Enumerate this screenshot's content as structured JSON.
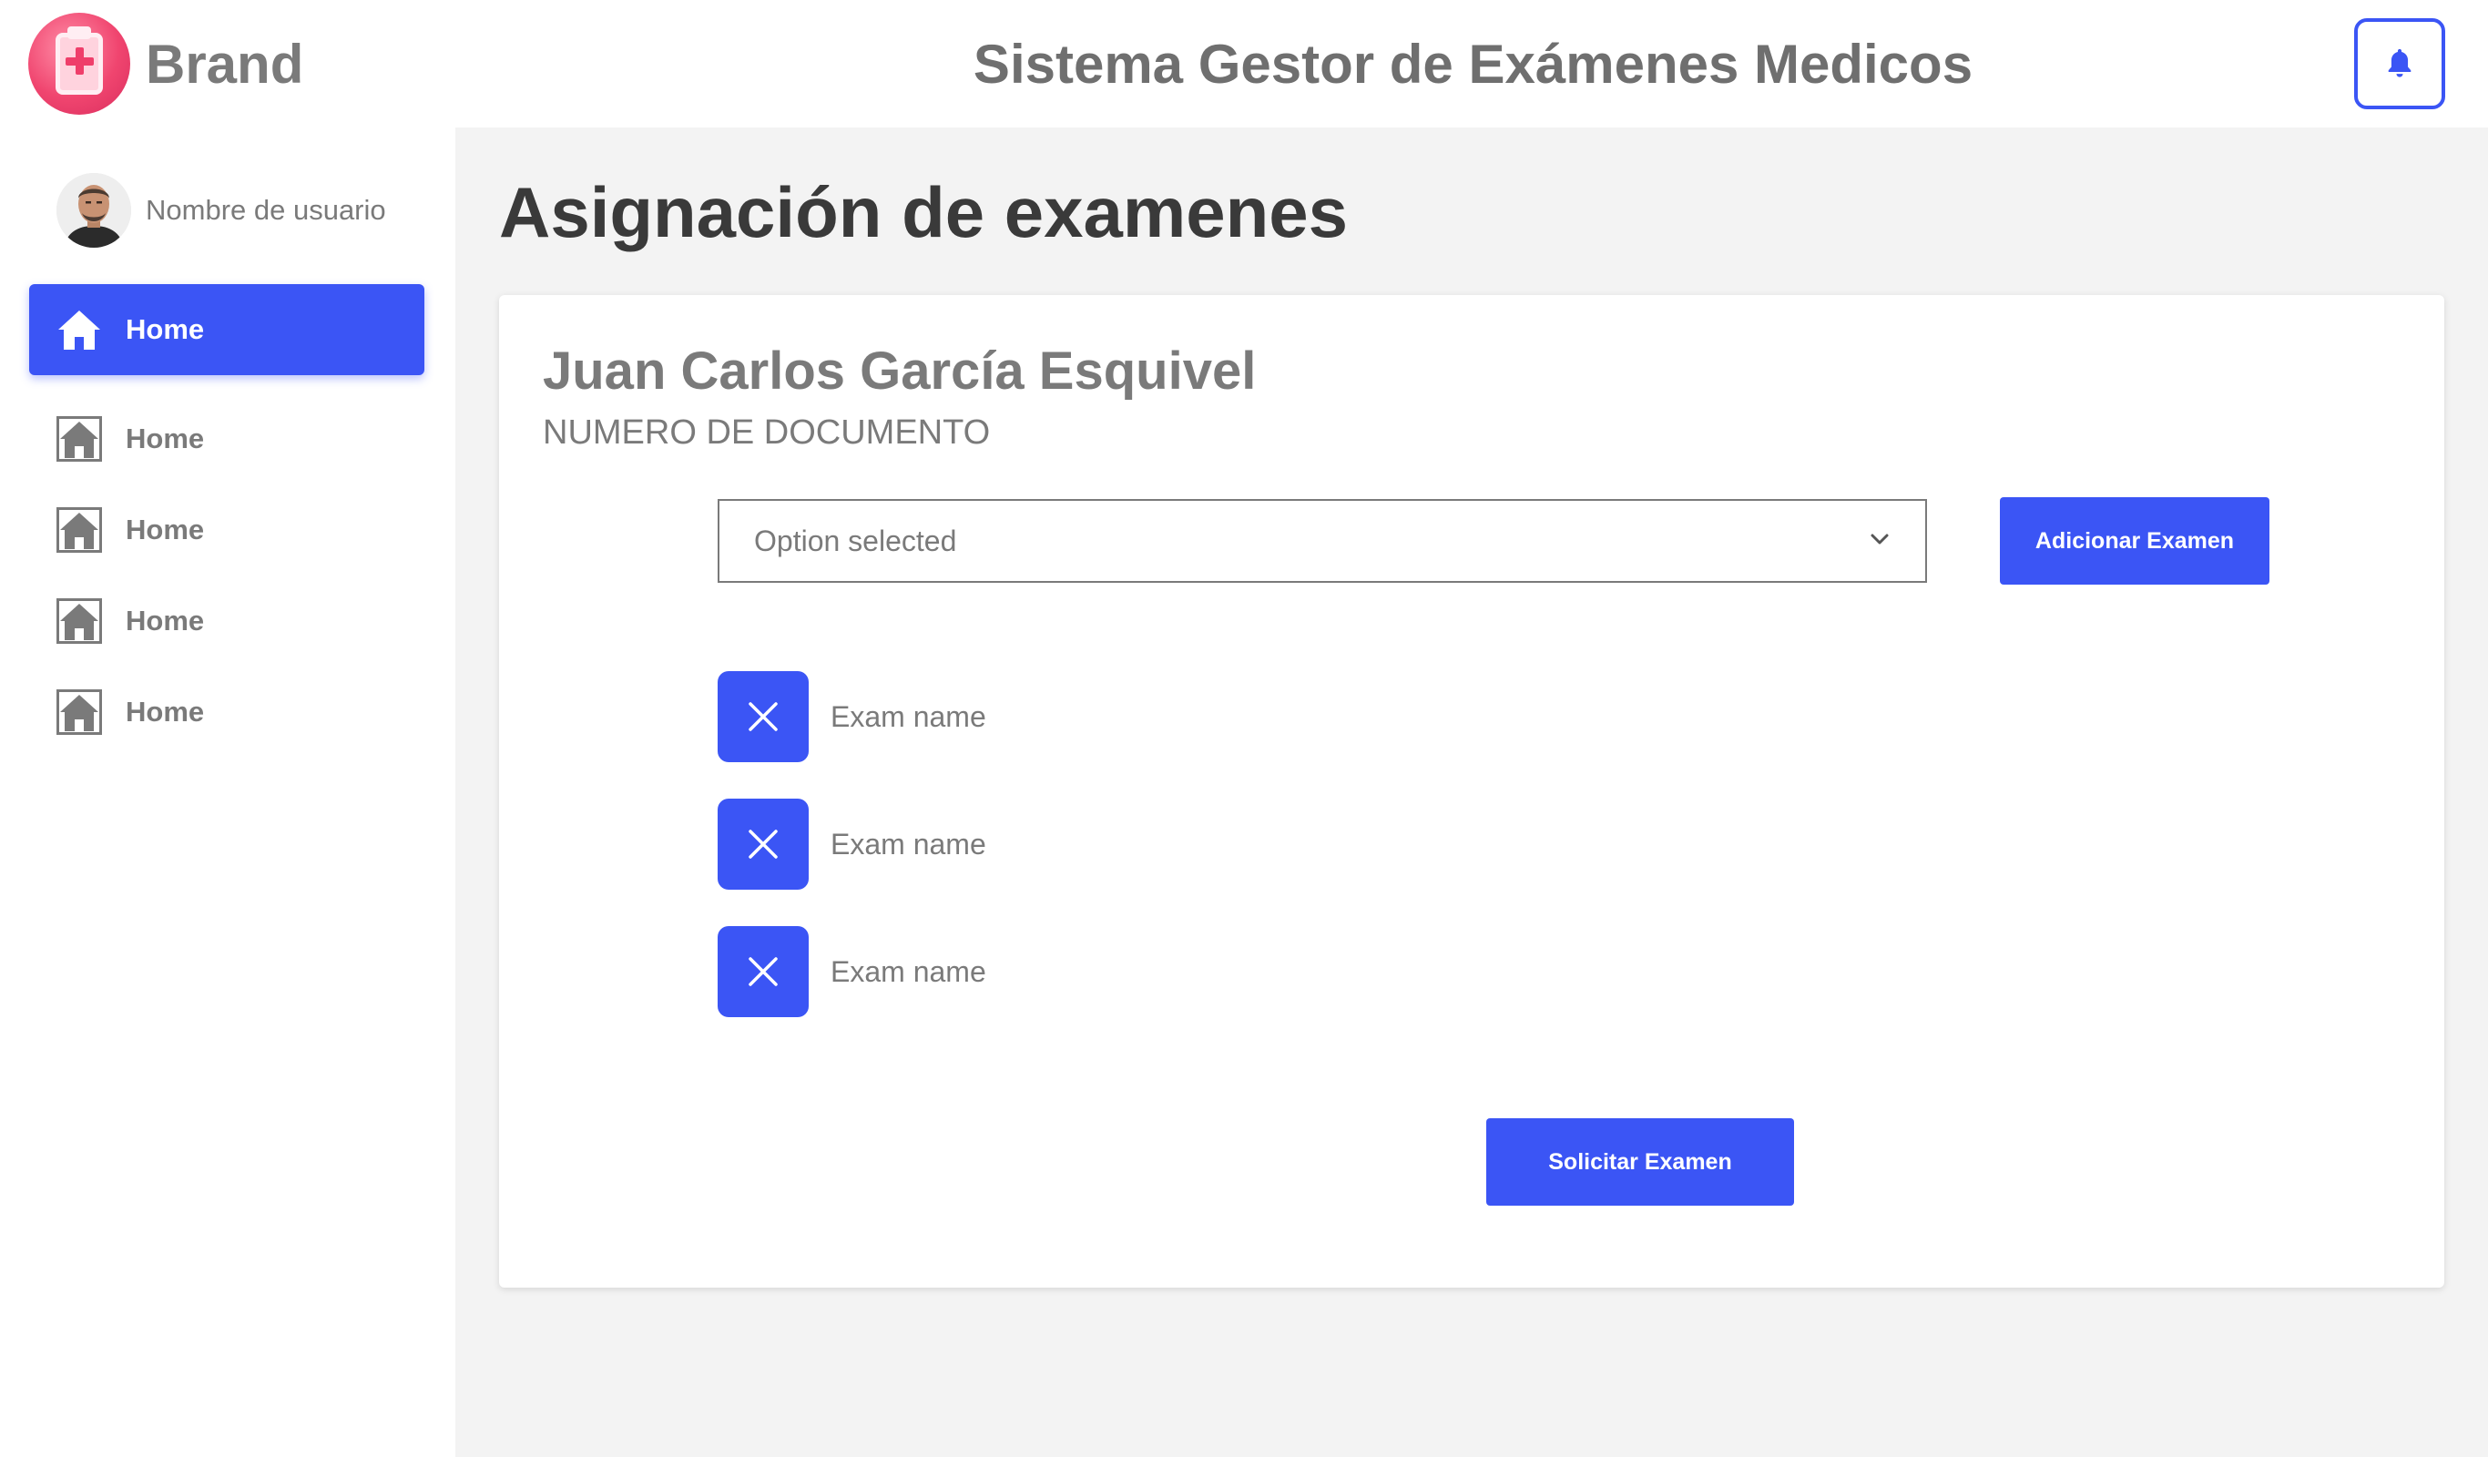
{
  "header": {
    "brand": "Brand",
    "title": "Sistema Gestor de Exámenes Medicos",
    "brand_color": "#f0456f",
    "accent_color": "#3b55f5",
    "icons": {
      "logo": "clipboard-medical-icon",
      "notifications": "bell-icon"
    }
  },
  "sidebar": {
    "user_name": "Nombre de usuario",
    "items": [
      {
        "label": "Home",
        "icon": "home-icon",
        "active": true
      },
      {
        "label": "Home",
        "icon": "home-icon",
        "active": false
      },
      {
        "label": "Home",
        "icon": "home-icon",
        "active": false
      },
      {
        "label": "Home",
        "icon": "home-icon",
        "active": false
      },
      {
        "label": "Home",
        "icon": "home-icon",
        "active": false
      }
    ]
  },
  "main": {
    "page_title": "Asignación de examenes",
    "patient": {
      "name": "Juan Carlos García Esquivel",
      "document_label": "NUMERO DE DOCUMENTO"
    },
    "exam_select": {
      "selected": "Option selected",
      "icon": "chevron-down-icon"
    },
    "add_button": "Adicionar Examen",
    "exams": [
      {
        "name": "Exam name",
        "icon": "close-icon"
      },
      {
        "name": "Exam name",
        "icon": "close-icon"
      },
      {
        "name": "Exam name",
        "icon": "close-icon"
      }
    ],
    "submit_button": "Solicitar Examen"
  }
}
